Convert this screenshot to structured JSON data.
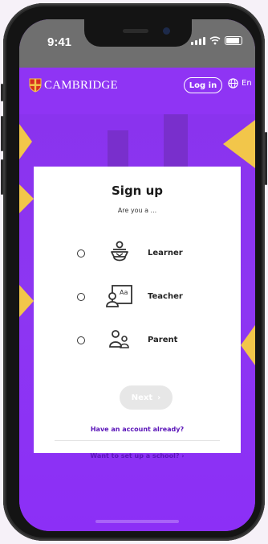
{
  "status_bar": {
    "time": "9:41"
  },
  "header": {
    "brand": "CAMBRIDGE",
    "login_label": "Log in",
    "language": "En"
  },
  "signup": {
    "title": "Sign up",
    "subtitle": "Are you a ...",
    "roles": [
      {
        "label": "Learner",
        "icon": "learner-icon"
      },
      {
        "label": "Teacher",
        "icon": "teacher-icon"
      },
      {
        "label": "Parent",
        "icon": "parent-icon"
      }
    ],
    "next_label": "Next",
    "next_arrow": "›",
    "account_link": "Have an account already?",
    "school_link": "Want to set up a school?",
    "school_arrow": "›"
  },
  "colors": {
    "brand_purple": "#8f34f4",
    "accent_yellow": "#f2c64a",
    "link_purple": "#5a14b8",
    "disabled_button": "#e7e7e7"
  }
}
